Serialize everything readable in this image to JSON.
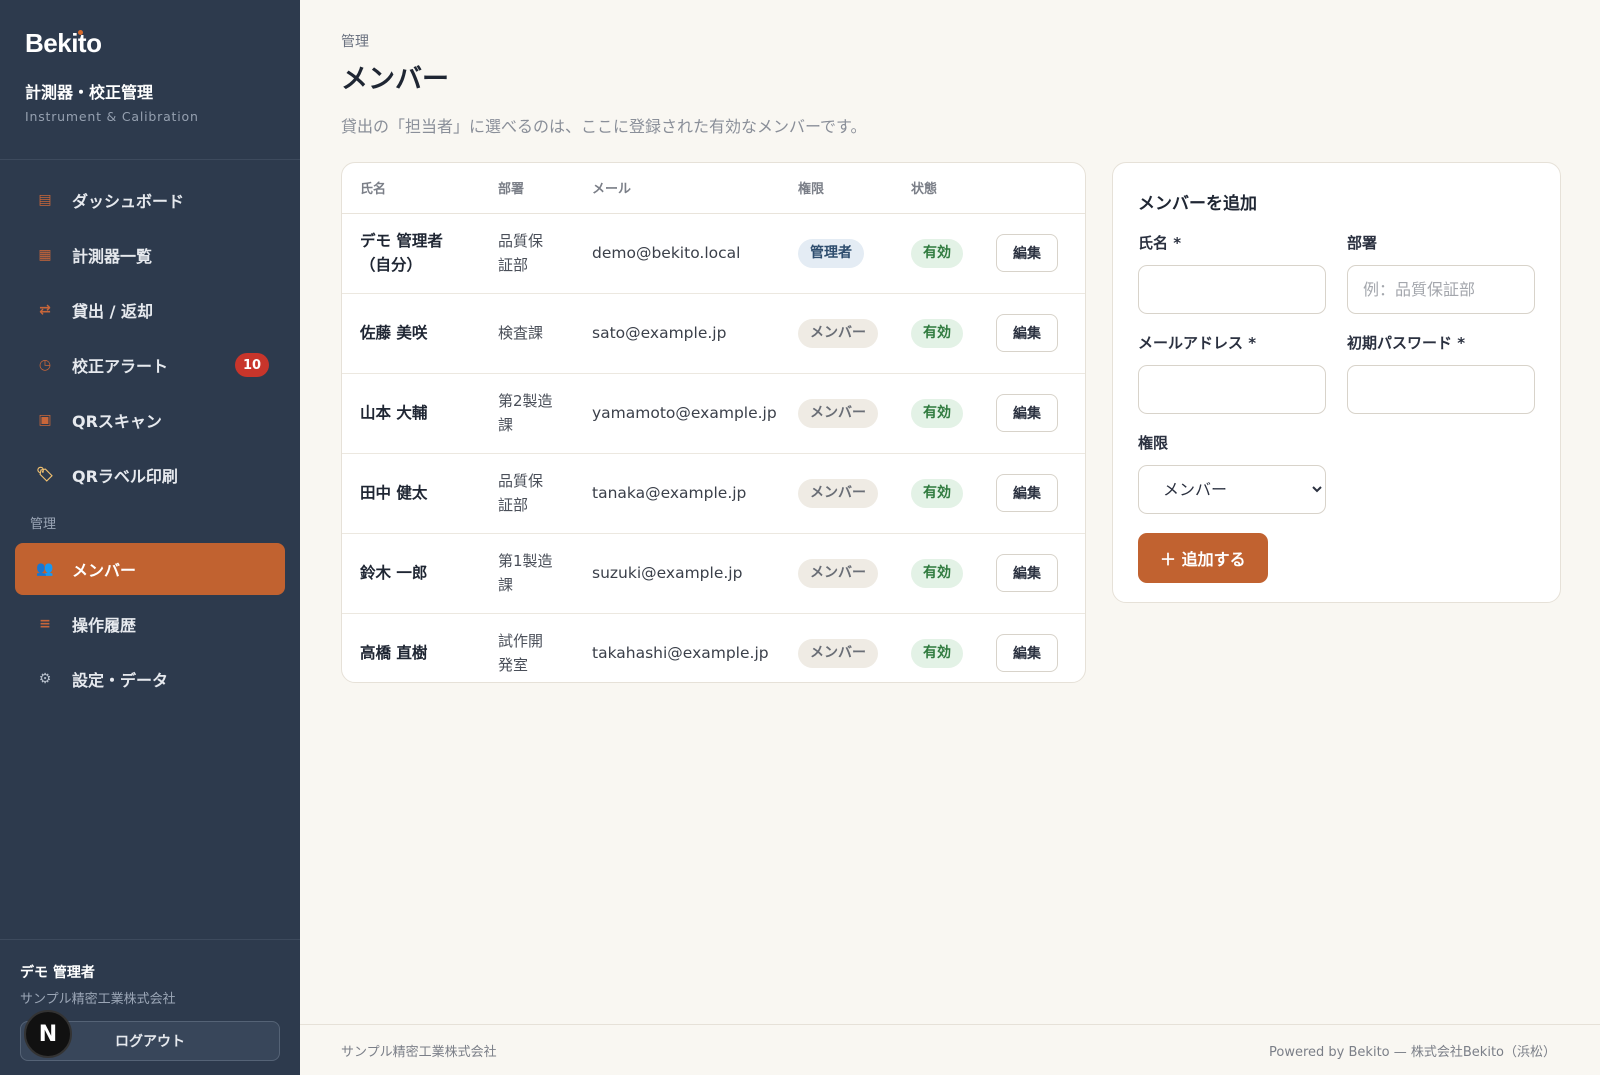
{
  "brand": {
    "logo": "Bekito",
    "title": "計測器・校正管理",
    "subtitle": "Instrument & Calibration"
  },
  "nav": {
    "items": [
      {
        "label": "ダッシュボード",
        "icon": "dashboard-icon"
      },
      {
        "label": "計測器一覧",
        "icon": "instrument-list-icon"
      },
      {
        "label": "貸出 / 返却",
        "icon": "swap-icon"
      },
      {
        "label": "校正アラート",
        "icon": "clock-icon",
        "badge": "10"
      },
      {
        "label": "QRスキャン",
        "icon": "qr-scan-icon"
      },
      {
        "label": "QRラベル印刷",
        "icon": "label-icon"
      }
    ],
    "section_label": "管理",
    "admin_items": [
      {
        "label": "メンバー",
        "icon": "users-icon",
        "active": true
      },
      {
        "label": "操作履歴",
        "icon": "history-icon"
      },
      {
        "label": "設定・データ",
        "icon": "gear-icon"
      }
    ]
  },
  "user": {
    "name": "デモ 管理者",
    "org": "サンプル精密工業株式会社",
    "logout": "ログアウト",
    "avatar_letter": "N"
  },
  "page": {
    "breadcrumb": "管理",
    "title": "メンバー",
    "description": "貸出の「担当者」に選べるのは、ここに登録された有効なメンバーです。"
  },
  "table": {
    "headers": [
      "氏名",
      "部署",
      "メール",
      "権限",
      "状態"
    ],
    "rows": [
      {
        "name": "デモ 管理者\n（自分）",
        "dept": "品質保\n証部",
        "email": "demo@bekito.local",
        "role": "管理者",
        "role_type": "admin",
        "status": "有効",
        "edit": "編集"
      },
      {
        "name": "佐藤 美咲",
        "dept": "検査課",
        "email": "sato@example.jp",
        "role": "メンバー",
        "role_type": "member",
        "status": "有効",
        "edit": "編集"
      },
      {
        "name": "山本 大輔",
        "dept": "第2製造\n課",
        "email": "yamamoto@example.jp",
        "role": "メンバー",
        "role_type": "member",
        "status": "有効",
        "edit": "編集"
      },
      {
        "name": "田中 健太",
        "dept": "品質保\n証部",
        "email": "tanaka@example.jp",
        "role": "メンバー",
        "role_type": "member",
        "status": "有効",
        "edit": "編集"
      },
      {
        "name": "鈴木 一郎",
        "dept": "第1製造\n課",
        "email": "suzuki@example.jp",
        "role": "メンバー",
        "role_type": "member",
        "status": "有効",
        "edit": "編集"
      },
      {
        "name": "高橋 直樹",
        "dept": "試作開\n発室",
        "email": "takahashi@example.jp",
        "role": "メンバー",
        "role_type": "member",
        "status": "有効",
        "edit": "編集"
      }
    ]
  },
  "add_form": {
    "title": "メンバーを追加",
    "name_label": "氏名 *",
    "name_value": "",
    "dept_label": "部署",
    "dept_placeholder": "例：品質保証部",
    "email_label": "メールアドレス *",
    "password_label": "初期パスワード *",
    "role_label": "権限",
    "role_selected": "メンバー",
    "submit": "＋ 追加する"
  },
  "footer": {
    "left": "サンプル精密工業株式会社",
    "right": "Powered by Bekito — 株式会社Bekito（浜松）"
  },
  "colors": {
    "sidebar": "#2d3a4d",
    "accent": "#c16230",
    "badge": "#c8352b",
    "background": "#f9f7f2"
  }
}
